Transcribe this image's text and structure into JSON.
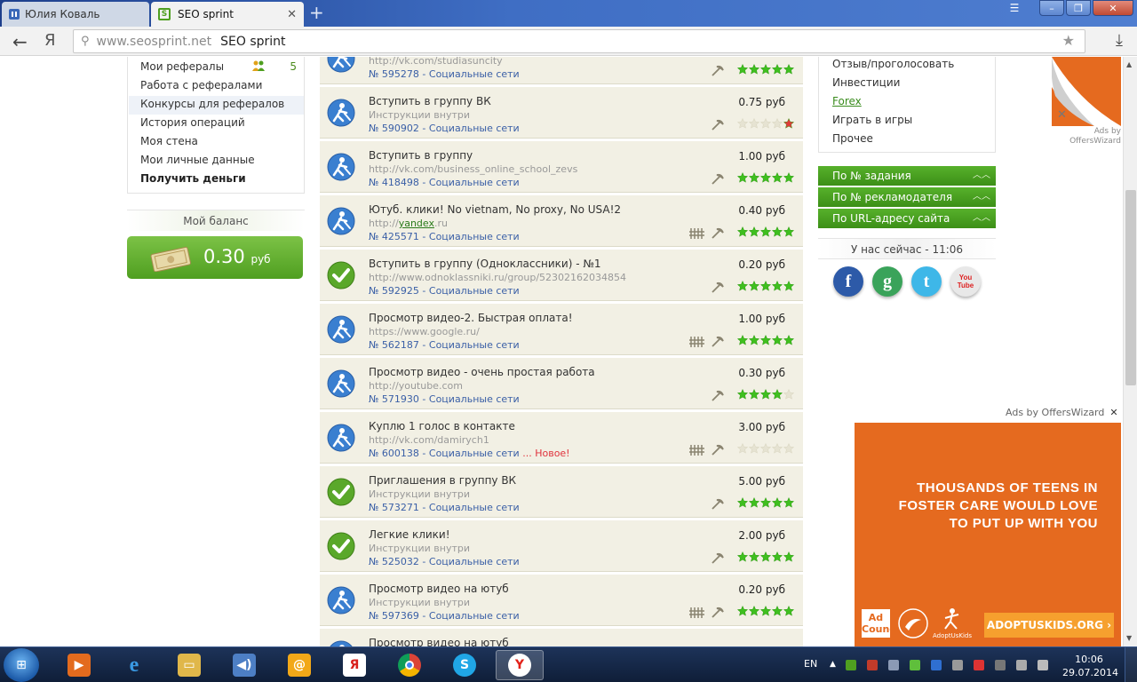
{
  "browser": {
    "tabs": [
      {
        "label": "Юлия Коваль"
      },
      {
        "label": "SEO sprint"
      }
    ],
    "address_host": "www.seosprint.net",
    "address_title": "SEO sprint",
    "ya_label": "Я"
  },
  "left_menu": {
    "items": [
      {
        "label": "Мои рефералы",
        "count": "5"
      },
      {
        "label": "Работа с рефералами"
      },
      {
        "label": "Конкурсы для рефералов"
      },
      {
        "label": "История операций"
      },
      {
        "label": "Моя стена"
      },
      {
        "label": "Мои личные данные"
      },
      {
        "label": "Получить деньги"
      }
    ]
  },
  "balance": {
    "header": "Мой баланс",
    "value": "0.30",
    "currency": "руб"
  },
  "tasks": [
    {
      "title": "",
      "url": "http://vk.com/studiasuncity",
      "num": "№ 595278 - Социальные сети",
      "price": "",
      "rating": 5,
      "red_star": false,
      "fence": false,
      "icon": "worker",
      "new": ""
    },
    {
      "title": "Вступить в группу ВК",
      "url": "Инструкции внутри",
      "num": "№ 590902 - Социальные сети",
      "price": "0.75 руб",
      "rating": 0,
      "red_star": true,
      "fence": false,
      "icon": "worker",
      "new": ""
    },
    {
      "title": "Вступить в группу",
      "url": "http://vk.com/business_online_school_zevs",
      "num": "№ 418498 - Социальные сети",
      "price": "1.00 руб",
      "rating": 5,
      "red_star": false,
      "fence": false,
      "icon": "worker",
      "new": ""
    },
    {
      "title": "Ютуб. клики! No vietnam, No proxy, No USA!2",
      "url": "http://",
      "url_link": "yandex",
      "url_tail": ".ru",
      "num": "№ 425571 - Социальные сети",
      "price": "0.40 руб",
      "rating": 5,
      "red_star": false,
      "fence": true,
      "icon": "worker",
      "new": ""
    },
    {
      "title": "Вступить в группу (Одноклассники) - №1",
      "url": "http://www.odnoklassniki.ru/group/52302162034854",
      "num": "№ 592925 - Социальные сети",
      "price": "0.20 руб",
      "rating": 5,
      "red_star": false,
      "fence": false,
      "icon": "check",
      "new": ""
    },
    {
      "title": "Просмотр видео-2. Быстрая оплата!",
      "url": "https://www.google.ru/",
      "num": "№ 562187 - Социальные сети",
      "price": "1.00 руб",
      "rating": 5,
      "red_star": false,
      "fence": true,
      "icon": "worker",
      "new": ""
    },
    {
      "title": "Просмотр видео - очень простая работа",
      "url": "http://youtube.com",
      "num": "№ 571930 - Социальные сети",
      "price": "0.30 руб",
      "rating": 4,
      "red_star": false,
      "fence": false,
      "icon": "worker",
      "new": ""
    },
    {
      "title": "Куплю 1 голос в контакте",
      "url": "http://vk.com/damirych1",
      "num": "№ 600138 - Социальные сети",
      "price": "3.00 руб",
      "rating": 0,
      "red_star": false,
      "fence": true,
      "icon": "worker",
      "new": "... Новое!"
    },
    {
      "title": "Приглашения в группу ВК",
      "url": "Инструкции внутри",
      "num": "№ 573271 - Социальные сети",
      "price": "5.00 руб",
      "rating": 5,
      "red_star": false,
      "fence": false,
      "icon": "check",
      "new": ""
    },
    {
      "title": "Легкие клики!",
      "url": "Инструкции внутри",
      "num": "№ 525032 - Социальные сети",
      "price": "2.00 руб",
      "rating": 5,
      "red_star": false,
      "fence": false,
      "icon": "check",
      "new": ""
    },
    {
      "title": "Просмотр видео на ютуб",
      "url": "Инструкции внутри",
      "num": "№ 597369 - Социальные сети",
      "price": "0.20 руб",
      "rating": 5,
      "red_star": false,
      "fence": true,
      "icon": "worker",
      "new": ""
    },
    {
      "title": "Просмотр видео на ютуб",
      "url": "",
      "num": "",
      "price": "",
      "rating": 0,
      "red_star": false,
      "fence": false,
      "icon": "worker",
      "new": ""
    }
  ],
  "right_menu": {
    "items": [
      {
        "label": "Отзыв/проголосовать"
      },
      {
        "label": "Инвестиции"
      },
      {
        "label": "Forex"
      },
      {
        "label": "Играть в игры"
      },
      {
        "label": "Прочее"
      }
    ]
  },
  "search_bars": [
    {
      "label": "По № задания"
    },
    {
      "label": "По № рекламодателя"
    },
    {
      "label": "По URL-адресу сайта"
    }
  ],
  "now_header": "У нас сейчас - 11:06",
  "social": [
    {
      "name": "facebook-icon",
      "glyph": "f",
      "color": "#2d5aa8"
    },
    {
      "name": "google-icon",
      "glyph": "g",
      "color": "#3aa35a"
    },
    {
      "name": "twitter-icon",
      "glyph": "t",
      "color": "#3eb7e8"
    },
    {
      "name": "youtube-icon",
      "glyph": "You Tube",
      "color": "#e8e8e8"
    }
  ],
  "ads": {
    "small_label": "Ads by OffersWizard",
    "big_label": "Ads by OffersWizard",
    "headline": "THOUSANDS OF TEENS IN FOSTER CARE WOULD LOVE TO PUT UP WITH YOU",
    "url": "ADOPTUSKIDS.ORG",
    "logo_text": "Ad Council",
    "logo3_text": "AdoptUsKids"
  },
  "taskbar": {
    "lang": "EN",
    "time": "10:06",
    "date": "29.07.2014"
  },
  "colors": {
    "accent_green": "#4f9f20",
    "link_blue": "#3a5fa6",
    "ad_orange": "#e56a1f",
    "new_red": "#e0323c"
  }
}
